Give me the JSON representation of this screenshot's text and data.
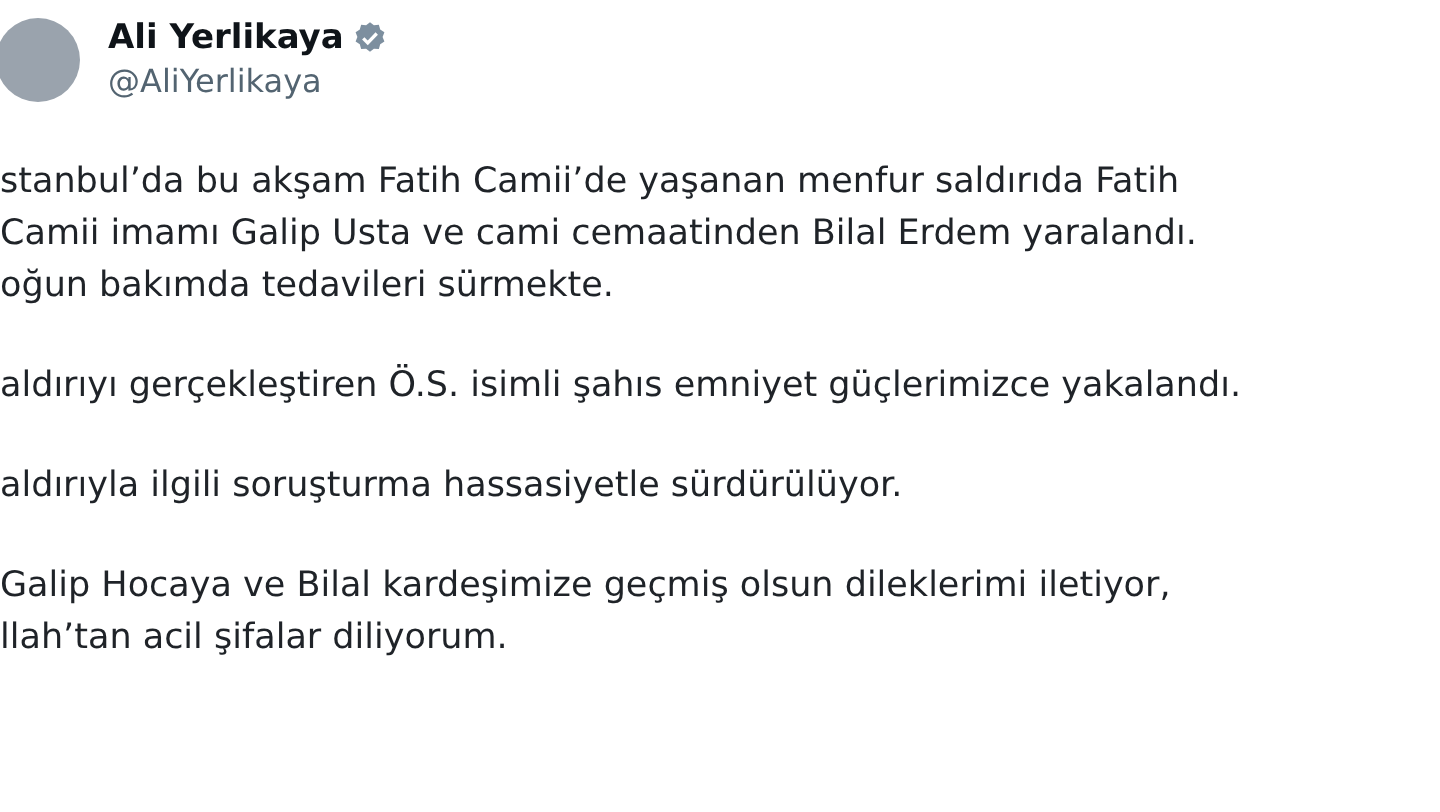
{
  "author": {
    "name": "Ali Yerlikaya",
    "handle": "@AliYerlikaya",
    "verified": true
  },
  "paragraphs": [
    {
      "lines": [
        "stanbul’da bu akşam Fatih Camii’de yaşanan menfur saldırıda Fatih",
        "Camii imamı Galip Usta ve cami cemaatinden Bilal Erdem yaralandı.",
        "oğun bakımda tedavileri sürmekte."
      ]
    },
    {
      "lines": [
        "aldırıyı gerçekleştiren Ö.S. isimli şahıs emniyet güçlerimizce yakalandı."
      ]
    },
    {
      "lines": [
        "aldırıyla ilgili soruşturma hassasiyetle sürdürülüyor."
      ]
    },
    {
      "lines": [
        "Galip Hocaya ve Bilal kardeşimize geçmiş olsun dileklerimi iletiyor,",
        "llah’tan acil şifalar diliyorum."
      ]
    }
  ]
}
